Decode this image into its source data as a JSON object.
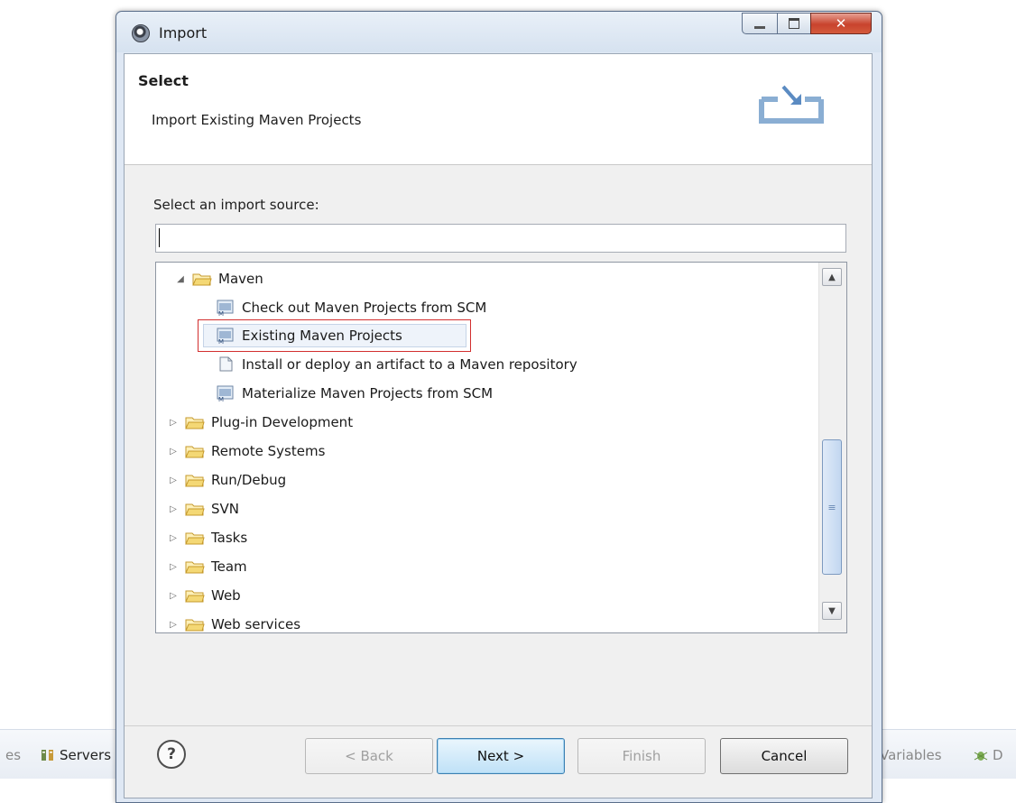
{
  "window": {
    "title": "Import"
  },
  "header": {
    "title": "Select",
    "description": "Import Existing Maven Projects"
  },
  "source": {
    "label": "Select an import source:",
    "filter_value": ""
  },
  "tree": {
    "items": [
      {
        "label": "Maven",
        "type": "folder",
        "expanded": true
      },
      {
        "label": "Check out Maven Projects from SCM",
        "type": "maven-wizard"
      },
      {
        "label": "Existing Maven Projects",
        "type": "maven-wizard",
        "selected": true
      },
      {
        "label": "Install or deploy an artifact to a Maven repository",
        "type": "artifact-wizard"
      },
      {
        "label": "Materialize Maven Projects from SCM",
        "type": "maven-wizard"
      },
      {
        "label": "Plug-in Development",
        "type": "folder"
      },
      {
        "label": "Remote Systems",
        "type": "folder"
      },
      {
        "label": "Run/Debug",
        "type": "folder"
      },
      {
        "label": "SVN",
        "type": "folder"
      },
      {
        "label": "Tasks",
        "type": "folder"
      },
      {
        "label": "Team",
        "type": "folder"
      },
      {
        "label": "Web",
        "type": "folder"
      },
      {
        "label": "Web services",
        "type": "folder"
      }
    ]
  },
  "buttons": {
    "back": "< Back",
    "next": "Next >",
    "finish": "Finish",
    "cancel": "Cancel",
    "help": "?"
  },
  "background": {
    "tab_left_fragment": "es",
    "servers_tab": "Servers",
    "variables_tab": "Variables",
    "right_fragment": "D"
  },
  "colors": {
    "selection_outline": "#d22f2f",
    "default_button": "#3c7fb1"
  }
}
